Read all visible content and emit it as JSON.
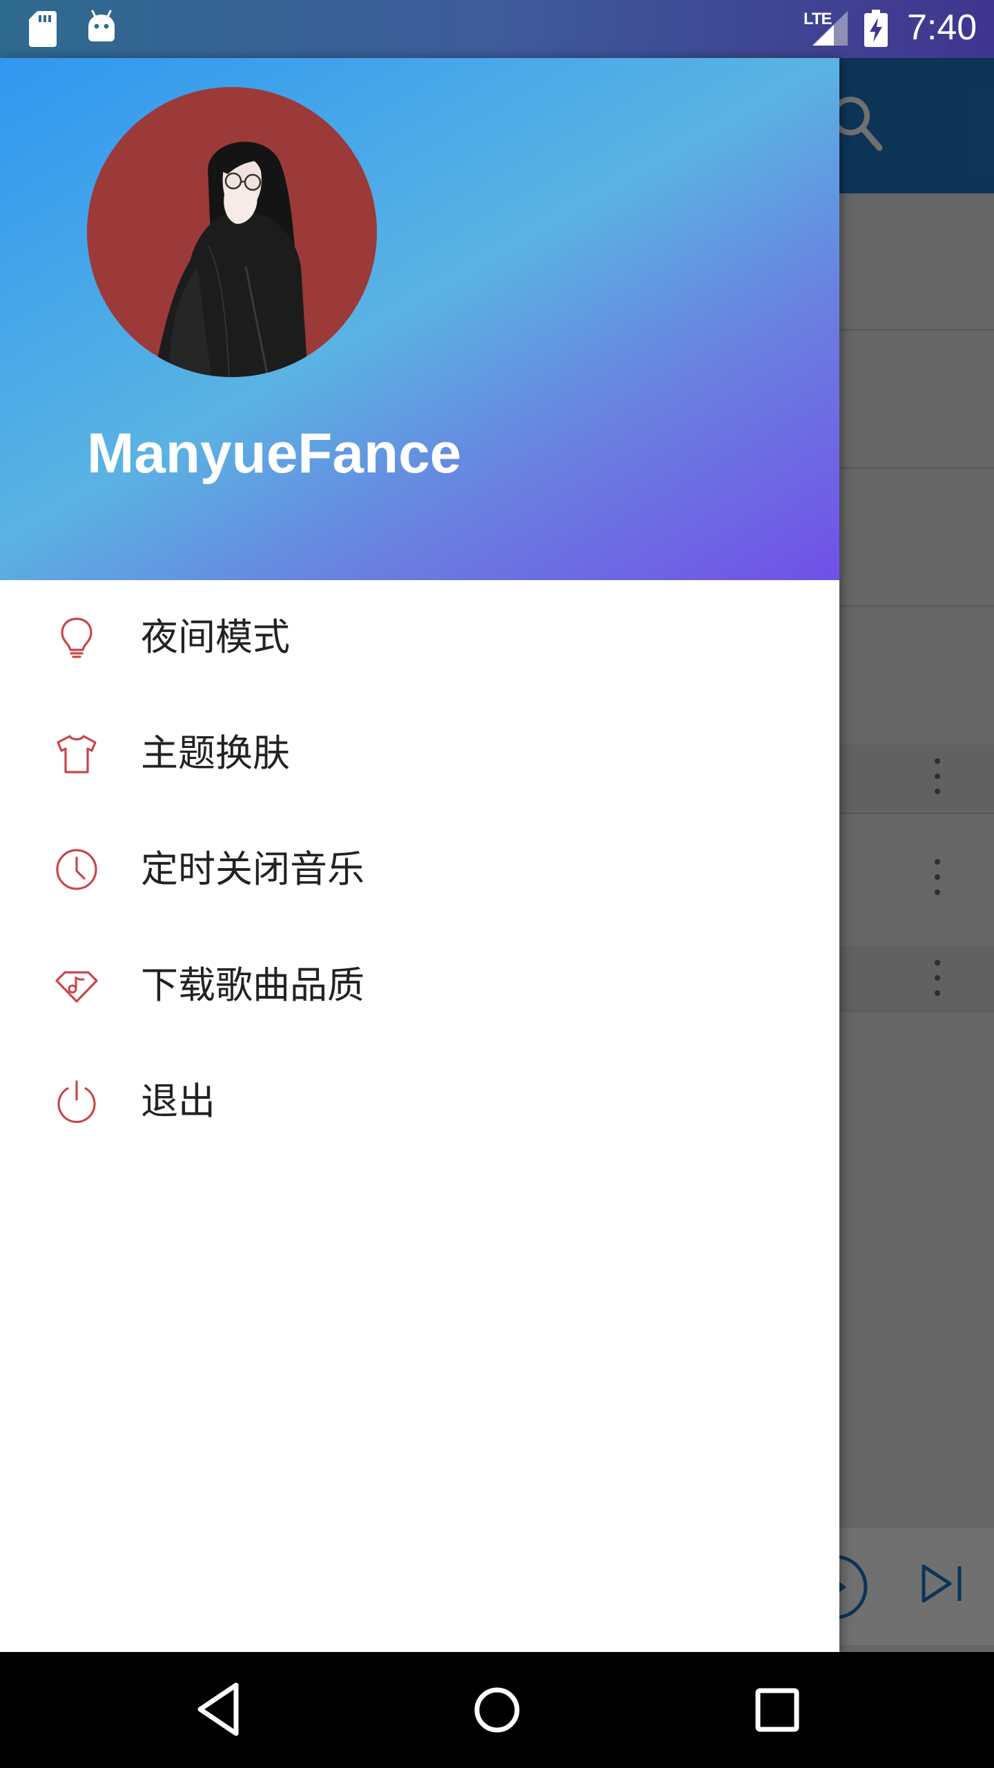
{
  "status_bar": {
    "time": "7:40",
    "network": "LTE",
    "icons": [
      "sd-card-icon",
      "android-icon",
      "signal-icon",
      "battery-charging-icon"
    ]
  },
  "drawer": {
    "header": {
      "username": "ManyueFance",
      "avatar": "avatar-illustration"
    },
    "menu": [
      {
        "label": "夜间模式",
        "icon": "lightbulb-icon"
      },
      {
        "label": "主题换肤",
        "icon": "tshirt-icon"
      },
      {
        "label": "定时关闭音乐",
        "icon": "clock-icon"
      },
      {
        "label": "下载歌曲品质",
        "icon": "music-tag-icon"
      },
      {
        "label": "退出",
        "icon": "power-icon"
      }
    ],
    "accent_color": "#c9454a"
  },
  "nav_bar": {
    "icons": [
      "back-icon",
      "home-icon",
      "recents-icon"
    ]
  }
}
